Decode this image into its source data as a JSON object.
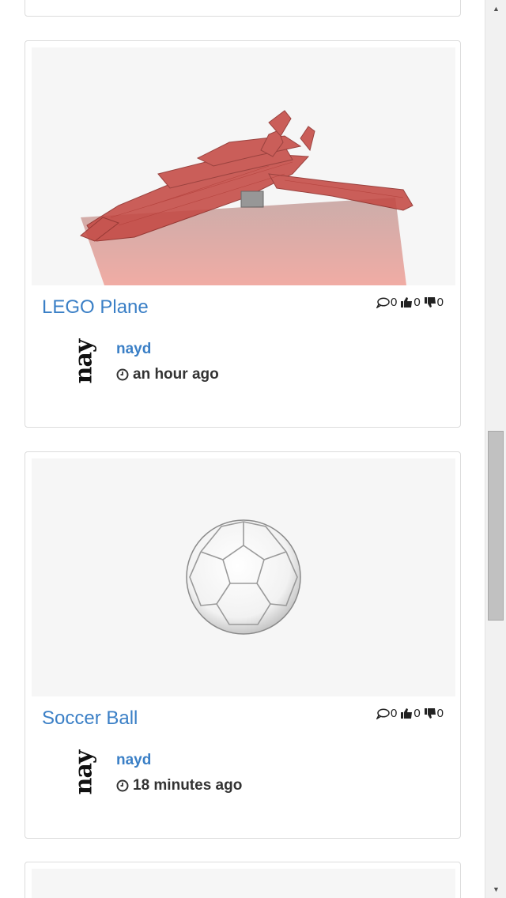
{
  "cards": [
    {
      "title": "LEGO Plane",
      "comments": "0",
      "likes": "0",
      "dislikes": "0",
      "author": "nayd",
      "avatar_text": "nay",
      "time": "an hour ago",
      "thumbnail": "red-lego-plane-model"
    },
    {
      "title": "Soccer Ball",
      "comments": "0",
      "likes": "0",
      "dislikes": "0",
      "author": "nayd",
      "avatar_text": "nay",
      "time": "18 minutes ago",
      "thumbnail": "white-soccer-ball-model"
    }
  ],
  "icons": {
    "comment": "comment-icon",
    "like": "thumbs-up-icon",
    "dislike": "thumbs-down-icon",
    "time": "clock-icon"
  },
  "colors": {
    "link": "#3a7fc6",
    "model_red": "#c0392b",
    "thumb_bg": "#f6f6f6"
  },
  "scrollbar": {
    "position_fraction": 0.55
  }
}
